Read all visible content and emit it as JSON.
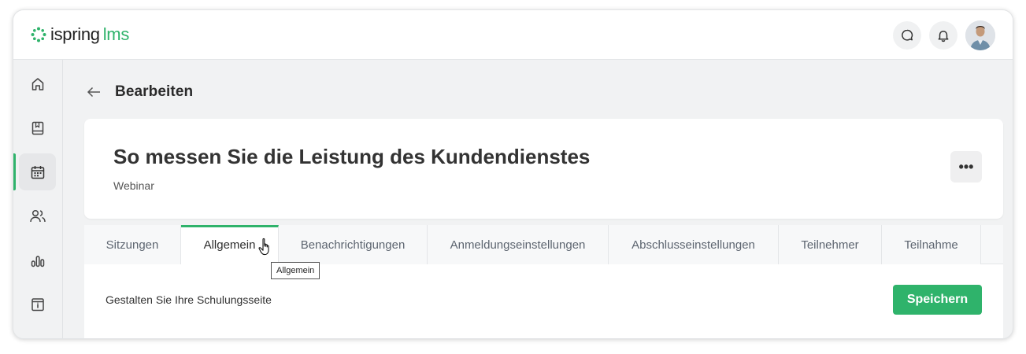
{
  "brand": {
    "name": "ispring",
    "product": "lms",
    "accent": "#2fb36b"
  },
  "topbar": {
    "icons": [
      "chat-icon",
      "bell-icon"
    ],
    "avatar": "user-avatar"
  },
  "sidebar": {
    "items": [
      {
        "icon": "home-icon",
        "active": false
      },
      {
        "icon": "book-icon",
        "active": false
      },
      {
        "icon": "calendar-icon",
        "active": true
      },
      {
        "icon": "users-icon",
        "active": false
      },
      {
        "icon": "reports-icon",
        "active": false
      },
      {
        "icon": "info-icon",
        "active": false
      }
    ]
  },
  "header": {
    "back": "←",
    "title": "Bearbeiten"
  },
  "event": {
    "title": "So messen Sie die Leistung des Kundendienstes",
    "type": "Webinar",
    "more": "•••"
  },
  "tabs": [
    {
      "label": "Sitzungen",
      "active": false
    },
    {
      "label": "Allgemein",
      "active": true
    },
    {
      "label": "Benachrichtigungen",
      "active": false
    },
    {
      "label": "Anmeldungseinstellungen",
      "active": false
    },
    {
      "label": "Abschlusseinstellungen",
      "active": false
    },
    {
      "label": "Teilnehmer",
      "active": false
    },
    {
      "label": "Teilnahme",
      "active": false
    }
  ],
  "tooltip": "Allgemein",
  "content": {
    "description": "Gestalten Sie Ihre Schulungsseite",
    "save": "Speichern"
  }
}
